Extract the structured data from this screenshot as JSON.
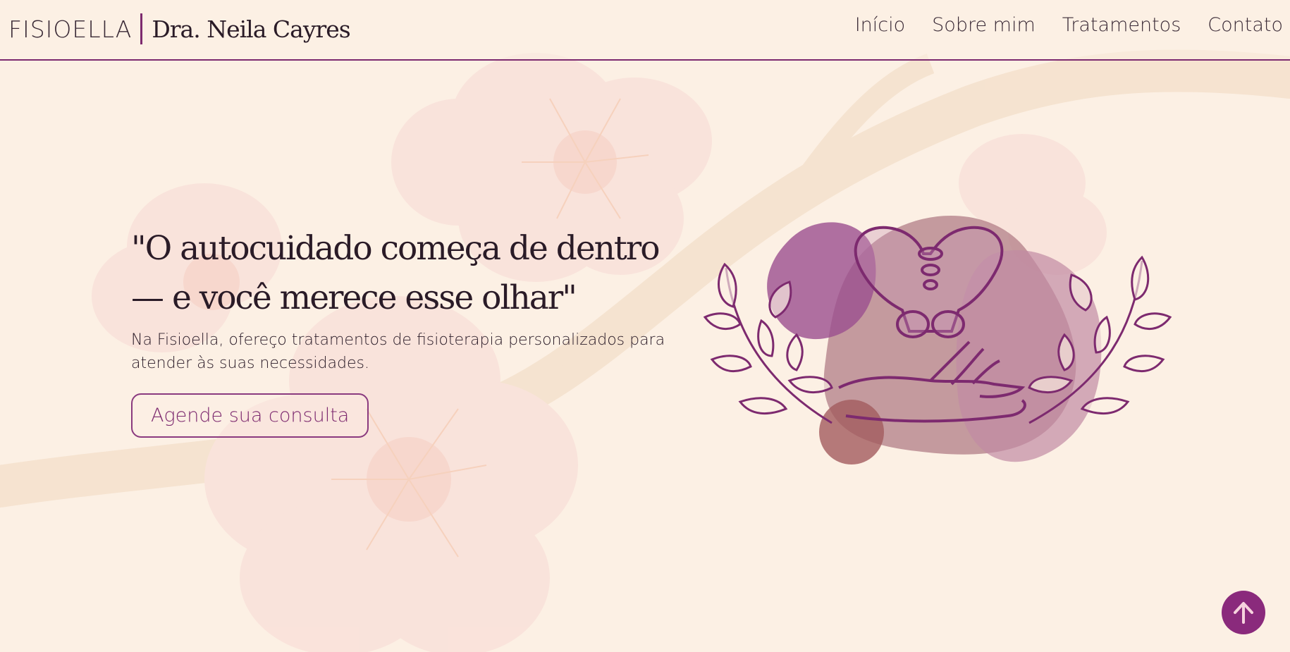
{
  "header": {
    "brand_name": "FISIOELLA",
    "doctor_name": "Dra. Neila Cayres",
    "nav": [
      {
        "label": "Início"
      },
      {
        "label": "Sobre mim"
      },
      {
        "label": "Tratamentos"
      },
      {
        "label": "Contato"
      }
    ]
  },
  "hero": {
    "title_line1": "\"O autocuidado começa de dentro",
    "title_line2": "— e você merece esse olhar\"",
    "subtitle": "Na Fisioella, ofereço tratamentos de fisioterapia personalizados para atender às suas necessidades.",
    "cta_label": "Agende sua consulta"
  },
  "icons": {
    "illustration": "pelvis-hand-laurel-icon",
    "scroll_top": "arrow-up-icon"
  },
  "colors": {
    "accent": "#7d2a6f",
    "background": "#fcf0e4",
    "scroll_button": "#8a2a7c"
  }
}
